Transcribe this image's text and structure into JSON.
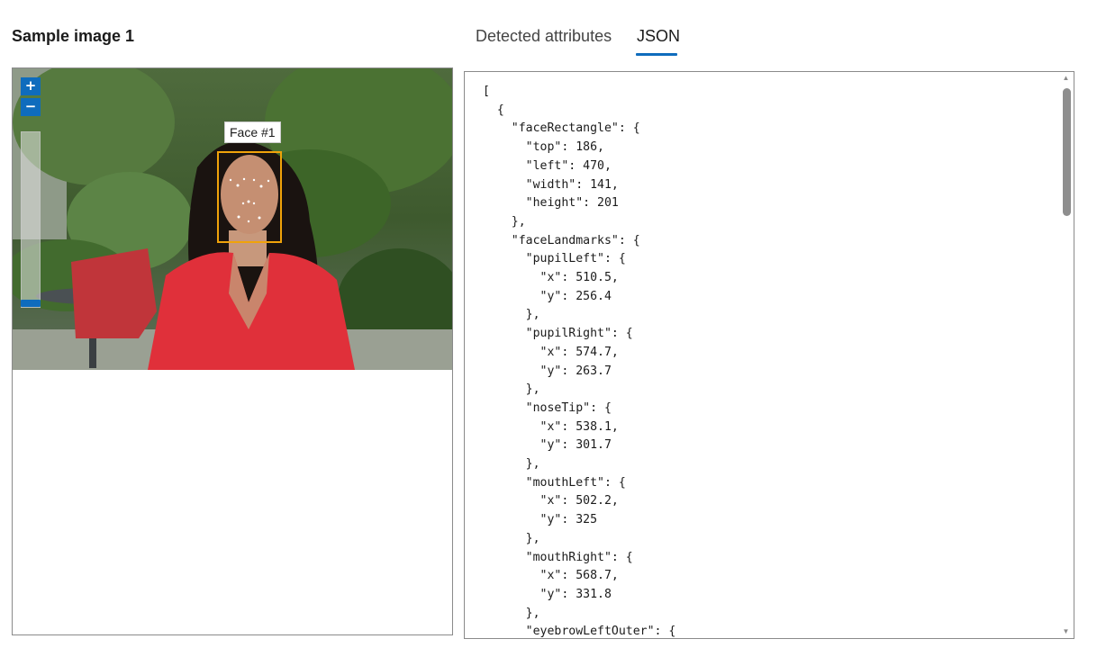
{
  "page_title": "Sample image 1",
  "tabs": [
    {
      "label": "Detected attributes",
      "active": false
    },
    {
      "label": "JSON",
      "active": true
    }
  ],
  "viewer": {
    "zoom_in_label": "+",
    "zoom_out_label": "−",
    "face_label": "Face #1",
    "zoom_level": 0,
    "face_box_color": "#f0a30a"
  },
  "json_lines": [
    "[",
    "  {",
    "    \"faceRectangle\": {",
    "      \"top\": 186,",
    "      \"left\": 470,",
    "      \"width\": 141,",
    "      \"height\": 201",
    "    },",
    "    \"faceLandmarks\": {",
    "      \"pupilLeft\": {",
    "        \"x\": 510.5,",
    "        \"y\": 256.4",
    "      },",
    "      \"pupilRight\": {",
    "        \"x\": 574.7,",
    "        \"y\": 263.7",
    "      },",
    "      \"noseTip\": {",
    "        \"x\": 538.1,",
    "        \"y\": 301.7",
    "      },",
    "      \"mouthLeft\": {",
    "        \"x\": 502.2,",
    "        \"y\": 325",
    "      },",
    "      \"mouthRight\": {",
    "        \"x\": 568.7,",
    "        \"y\": 331.8",
    "      },",
    "      \"eyebrowLeftOuter\": {"
  ],
  "colors": {
    "accent": "#0f6cbd",
    "border": "#8a8a8a"
  }
}
